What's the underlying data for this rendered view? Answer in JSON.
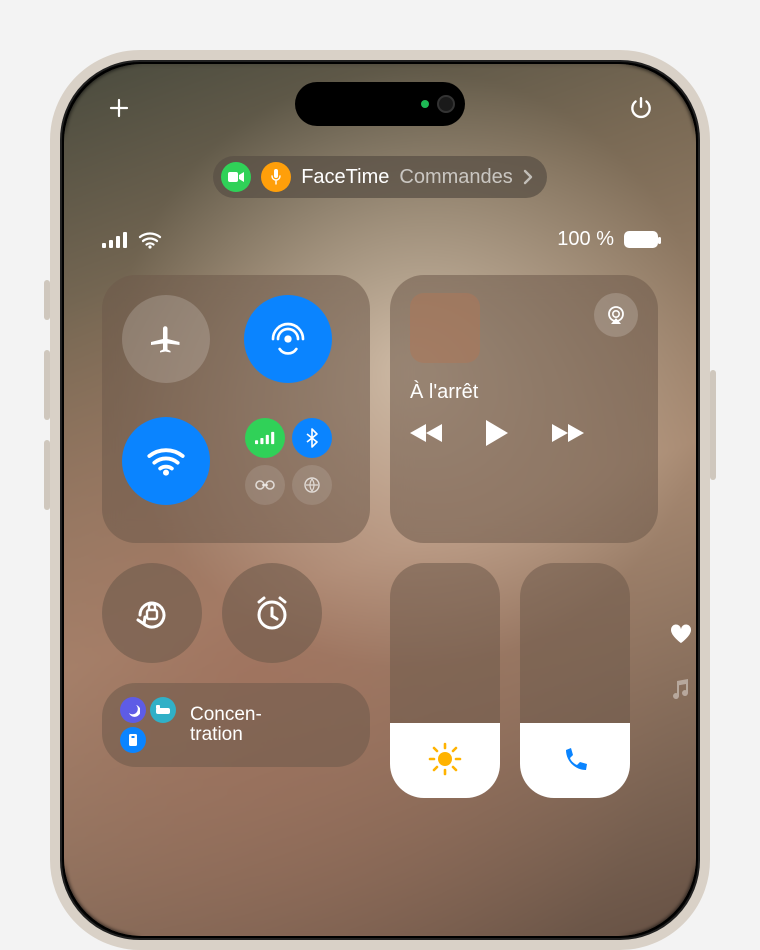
{
  "topbar": {
    "add_icon": "add-icon",
    "power_icon": "power-icon"
  },
  "facetime_bar": {
    "app_label": "FaceTime",
    "secondary_label": "Commandes",
    "camera_status": "on",
    "mic_status": "on"
  },
  "status": {
    "battery_text": "100 %",
    "cellular_bars": 4,
    "wifi_on": true
  },
  "connectivity": {
    "airplane": {
      "on": false,
      "icon": "airplane-icon"
    },
    "airdrop": {
      "on": true,
      "icon": "airdrop-icon"
    },
    "wifi": {
      "on": true,
      "icon": "wifi-icon"
    },
    "cellular": {
      "on": true,
      "icon": "cellular-icon"
    },
    "bluetooth": {
      "on": true,
      "icon": "bluetooth-icon"
    },
    "hotspot": {
      "on": false,
      "icon": "hotspot-icon"
    },
    "extra": {
      "on": false,
      "icon": "satellite-icon"
    }
  },
  "media": {
    "now_playing_label": "À l'arrêt",
    "airplay_icon": "airplay-icon",
    "prev_icon": "rewind-icon",
    "play_icon": "play-icon",
    "next_icon": "fastforward-icon"
  },
  "controls": {
    "orientation_lock_icon": "orientation-lock-icon",
    "alarm_icon": "alarm-clock-icon"
  },
  "focus": {
    "label": "Concen-\ntration",
    "modes": [
      "moon",
      "bed",
      "person"
    ]
  },
  "sliders": {
    "brightness": {
      "level_pct": 32,
      "icon": "sun-icon",
      "color": "#ffb300"
    },
    "volume": {
      "level_pct": 32,
      "icon": "phone-icon",
      "color": "#0a84ff"
    }
  },
  "page_dots": {
    "heart_icon": "heart-icon",
    "music_icon": "music-note-icon"
  }
}
